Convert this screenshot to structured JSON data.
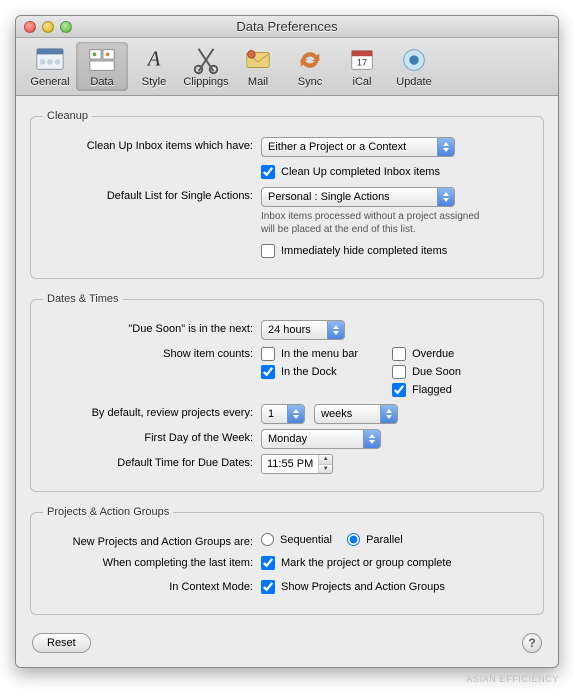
{
  "window": {
    "title": "Data Preferences"
  },
  "toolbar": {
    "items": [
      {
        "label": "General",
        "icon": "general-icon"
      },
      {
        "label": "Data",
        "icon": "data-icon",
        "selected": true
      },
      {
        "label": "Style",
        "icon": "style-icon"
      },
      {
        "label": "Clippings",
        "icon": "clippings-icon"
      },
      {
        "label": "Mail",
        "icon": "mail-icon"
      },
      {
        "label": "Sync",
        "icon": "sync-icon"
      },
      {
        "label": "iCal",
        "icon": "ical-icon"
      },
      {
        "label": "Update",
        "icon": "update-icon"
      }
    ]
  },
  "sections": {
    "cleanup": {
      "legend": "Cleanup",
      "clean_label": "Clean Up Inbox items which have:",
      "clean_value": "Either a Project or a Context",
      "clean_completed_label": "Clean Up completed Inbox items",
      "clean_completed_checked": true,
      "default_list_label": "Default List for Single Actions:",
      "default_list_value": "Personal : Single Actions",
      "help_text": "Inbox items processed without a project assigned will be placed at the end of this list.",
      "hide_completed_label": "Immediately hide completed items",
      "hide_completed_checked": false
    },
    "dates": {
      "legend": "Dates & Times",
      "due_soon_label": "\"Due Soon\" is in the next:",
      "due_soon_value": "24 hours",
      "show_counts_label": "Show item counts:",
      "counts": {
        "menu_bar": {
          "label": "In the menu bar",
          "checked": false
        },
        "dock": {
          "label": "In the Dock",
          "checked": true
        },
        "overdue": {
          "label": "Overdue",
          "checked": false
        },
        "due_soon": {
          "label": "Due Soon",
          "checked": false
        },
        "flagged": {
          "label": "Flagged",
          "checked": true
        }
      },
      "review_label": "By default, review projects every:",
      "review_num": "1",
      "review_unit": "weeks",
      "first_day_label": "First Day of the Week:",
      "first_day_value": "Monday",
      "default_time_label": "Default Time for Due Dates:",
      "default_time_value": "11:55 PM"
    },
    "projects": {
      "legend": "Projects & Action Groups",
      "new_projects_label": "New Projects and Action Groups are:",
      "sequential_label": "Sequential",
      "parallel_label": "Parallel",
      "parallel_selected": true,
      "completing_label": "When completing the last item:",
      "mark_complete_label": "Mark the project or group complete",
      "mark_complete_checked": true,
      "context_mode_label": "In Context Mode:",
      "show_projects_label": "Show Projects and Action Groups",
      "show_projects_checked": true
    }
  },
  "footer": {
    "reset": "Reset",
    "help": "?"
  },
  "watermark": "ASIAN EFFICIENCY"
}
